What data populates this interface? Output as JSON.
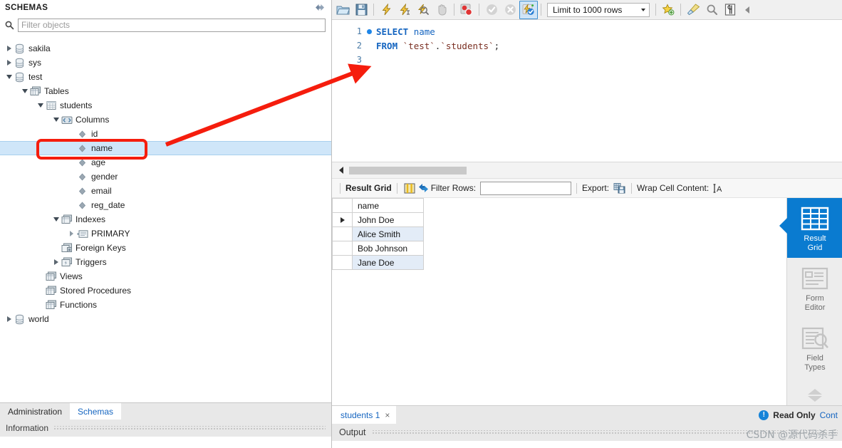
{
  "sidebar": {
    "title": "SCHEMAS",
    "header_icon": "refresh-icon",
    "filter": {
      "placeholder": "Filter objects",
      "value": "",
      "icon": "search-icon"
    },
    "tree": [
      {
        "label": "sakila",
        "indent": 0,
        "twisty": "closed",
        "icon": "schema-icon",
        "selected": false
      },
      {
        "label": "sys",
        "indent": 0,
        "twisty": "closed",
        "icon": "schema-icon",
        "selected": false
      },
      {
        "label": "test",
        "indent": 0,
        "twisty": "open",
        "icon": "schema-icon",
        "selected": false
      },
      {
        "label": "Tables",
        "indent": 1,
        "twisty": "open",
        "icon": "tables-icon",
        "selected": false
      },
      {
        "label": "students",
        "indent": 2,
        "twisty": "open",
        "icon": "table-icon",
        "selected": false
      },
      {
        "label": "Columns",
        "indent": 3,
        "twisty": "open",
        "icon": "columns-icon",
        "selected": false
      },
      {
        "label": "id",
        "indent": 4,
        "twisty": "none",
        "icon": "column-icon",
        "selected": false
      },
      {
        "label": "name",
        "indent": 4,
        "twisty": "none",
        "icon": "column-icon",
        "selected": true
      },
      {
        "label": "age",
        "indent": 4,
        "twisty": "none",
        "icon": "column-icon",
        "selected": false
      },
      {
        "label": "gender",
        "indent": 4,
        "twisty": "none",
        "icon": "column-icon",
        "selected": false
      },
      {
        "label": "email",
        "indent": 4,
        "twisty": "none",
        "icon": "column-icon",
        "selected": false
      },
      {
        "label": "reg_date",
        "indent": 4,
        "twisty": "none",
        "icon": "column-icon",
        "selected": false
      },
      {
        "label": "Indexes",
        "indent": 3,
        "twisty": "open",
        "icon": "indexes-icon",
        "selected": false
      },
      {
        "label": "PRIMARY",
        "indent": 4,
        "twisty": "tiny",
        "icon": "index-icon",
        "selected": false
      },
      {
        "label": "Foreign Keys",
        "indent": 3,
        "twisty": "none",
        "icon": "foreignkey-icon",
        "selected": false
      },
      {
        "label": "Triggers",
        "indent": 3,
        "twisty": "closed",
        "icon": "triggers-icon",
        "selected": false
      },
      {
        "label": "Views",
        "indent": 2,
        "twisty": "none",
        "icon": "views-icon",
        "selected": false
      },
      {
        "label": "Stored Procedures",
        "indent": 2,
        "twisty": "none",
        "icon": "procs-icon",
        "selected": false
      },
      {
        "label": "Functions",
        "indent": 2,
        "twisty": "none",
        "icon": "funcs-icon",
        "selected": false
      },
      {
        "label": "world",
        "indent": 0,
        "twisty": "closed",
        "icon": "schema-icon",
        "selected": false
      }
    ],
    "tabs": [
      {
        "label": "Administration",
        "active": false
      },
      {
        "label": "Schemas",
        "active": true
      }
    ],
    "information_label": "Information"
  },
  "toolbar": {
    "buttons": [
      {
        "name": "open-file-icon",
        "sep_after": false
      },
      {
        "name": "save-file-icon",
        "sep_after": true
      },
      {
        "name": "execute-statement-icon",
        "sep_after": false
      },
      {
        "name": "execute-current-statement-icon",
        "sep_after": false
      },
      {
        "name": "explain-statement-icon",
        "sep_after": false
      },
      {
        "name": "stop-execution-icon",
        "sep_after": true
      },
      {
        "name": "toggle-breakpoint-icon",
        "sep_after": true
      },
      {
        "name": "commit-icon",
        "sep_after": false
      },
      {
        "name": "rollback-icon",
        "sep_after": false
      },
      {
        "name": "autocommit-icon",
        "sep_after": true,
        "active": true
      }
    ],
    "limit_label": "Limit to 1000 rows",
    "right_buttons": [
      {
        "name": "snippets-icon"
      },
      {
        "name": "beautify-sql-icon"
      },
      {
        "name": "find-icon"
      },
      {
        "name": "invisible-chars-icon"
      }
    ],
    "collapse_icon": "collapse-left-icon"
  },
  "editor": {
    "lines": [
      {
        "number": "1",
        "marker": true,
        "tokens": [
          {
            "t": "SELECT",
            "c": "kw"
          },
          {
            "t": " ",
            "c": "punct"
          },
          {
            "t": "name",
            "c": "plain"
          }
        ]
      },
      {
        "number": "2",
        "marker": false,
        "tokens": [
          {
            "t": "FROM",
            "c": "kw"
          },
          {
            "t": " ",
            "c": "punct"
          },
          {
            "t": "`test`",
            "c": "ident"
          },
          {
            "t": ".",
            "c": "punct"
          },
          {
            "t": "`students`",
            "c": "ident"
          },
          {
            "t": ";",
            "c": "punct"
          }
        ]
      },
      {
        "number": "3",
        "marker": false,
        "tokens": []
      }
    ]
  },
  "results": {
    "toolbar": {
      "title": "Result Grid",
      "grid_icon": "grid-view-icon",
      "refresh_icon": "refresh-rows-icon",
      "filter_rows_label": "Filter Rows:",
      "filter_rows_value": "",
      "export_label": "Export:",
      "export_icon": "export-icon",
      "wrap_label": "Wrap Cell Content:",
      "wrap_icon": "wrap-text-icon"
    },
    "columns": [
      "name"
    ],
    "rows": [
      {
        "marker": true,
        "cells": [
          "John Doe"
        ]
      },
      {
        "marker": false,
        "cells": [
          "Alice Smith"
        ]
      },
      {
        "marker": false,
        "cells": [
          "Bob Johnson"
        ]
      },
      {
        "marker": false,
        "cells": [
          "Jane Doe"
        ]
      }
    ]
  },
  "side_panel": {
    "items": [
      {
        "line1": "Result",
        "line2": "Grid",
        "icon": "result-grid-icon",
        "active": true
      },
      {
        "line1": "Form",
        "line2": "Editor",
        "icon": "form-editor-icon",
        "active": false
      },
      {
        "line1": "Field",
        "line2": "Types",
        "icon": "field-types-icon",
        "active": false
      }
    ],
    "scroll_up_icon": "chevron-up-icon",
    "scroll_down_icon": "chevron-down-icon"
  },
  "bottom": {
    "result_tab": {
      "label": "students 1",
      "close": "×"
    },
    "read_only": "Read Only",
    "read_only_icon": "info-icon",
    "content_label": "Cont",
    "output_label": "Output"
  },
  "watermark": "CSDN @源代码杀手",
  "colors": {
    "accent_blue": "#0a7bd0",
    "selection_blue": "#cfe6f9",
    "annotation_red": "#f51d0d",
    "keyword_blue": "#1565c0",
    "identifier_red": "#7a2f22",
    "alt_row": "#e3ecf7"
  }
}
